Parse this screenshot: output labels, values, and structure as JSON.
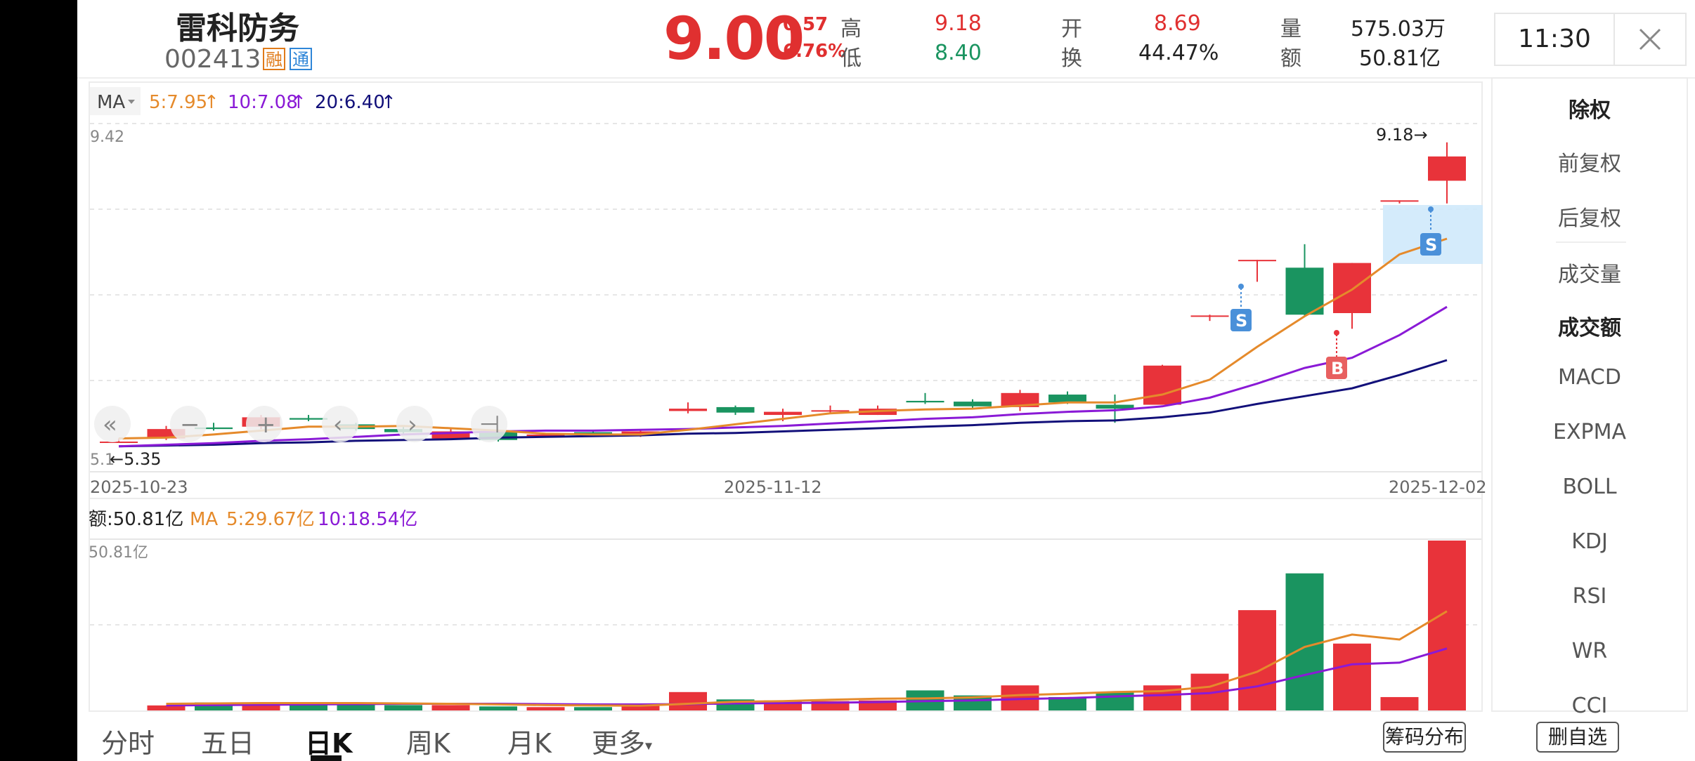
{
  "stock": {
    "name": "雷科防务",
    "code": "002413",
    "tags": [
      "融",
      "通"
    ],
    "price": "9.00",
    "change": "0.57",
    "change_pct": "6.76%",
    "high_label": "高",
    "high": "9.18",
    "low_label": "低",
    "low": "8.40",
    "open_label": "开",
    "open": "8.69",
    "turnover_label": "换",
    "turnover": "44.47%",
    "volume_label": "量",
    "volume": "575.03万",
    "amount_label": "额",
    "amount": "50.81亿"
  },
  "clock": "11:30",
  "colors": {
    "up": "#e8333a",
    "down": "#1a9460",
    "ma5": "#e58a2b",
    "ma10": "#8a1ad6",
    "ma20": "#12107a",
    "accent": "#2f86d8"
  },
  "ma_legend": {
    "selector": "MA",
    "ma5": "5:7.95",
    "ma10": "10:7.08",
    "ma20": "20:6.40",
    "arrow": "↑"
  },
  "price_axis": {
    "top": "9.42",
    "bottom": "5.1",
    "max_label": "9.18→",
    "min_label": "←5.35"
  },
  "dates": {
    "start": "2025-10-23",
    "mid": "2025-11-12",
    "end": "2025-12-02"
  },
  "markers": {
    "sell": "S",
    "buy": "B"
  },
  "volume_legend": {
    "amount": "额:50.81亿",
    "ma_label": "MA",
    "ma5": "5:29.67亿",
    "ma10": "10:18.54亿",
    "axis_top": "50.81亿"
  },
  "right_panel": [
    "除权",
    "前复权",
    "后复权",
    "成交量",
    "成交额",
    "MACD",
    "EXPMA",
    "BOLL",
    "KDJ",
    "RSI",
    "WR",
    "CCI"
  ],
  "tabs": [
    "分时",
    "五日",
    "日K",
    "周K",
    "月K",
    "更多"
  ],
  "buttons": {
    "chips": "筹码分布",
    "remove_watch": "删自选"
  },
  "zoom_controls": [
    "«",
    "−",
    "+",
    "‹",
    "›",
    "⊣"
  ],
  "chart_data": {
    "type": "candlestick",
    "price_range": [
      5.1,
      9.42
    ],
    "candles": [
      {
        "o": 5.35,
        "c": 5.36,
        "h": 5.4,
        "l": 5.35
      },
      {
        "o": 5.4,
        "c": 5.52,
        "h": 5.56,
        "l": 5.38
      },
      {
        "o": 5.54,
        "c": 5.52,
        "h": 5.6,
        "l": 5.5
      },
      {
        "o": 5.55,
        "c": 5.67,
        "h": 5.7,
        "l": 5.52
      },
      {
        "o": 5.66,
        "c": 5.64,
        "h": 5.7,
        "l": 5.62
      },
      {
        "o": 5.58,
        "c": 5.52,
        "h": 5.6,
        "l": 5.5
      },
      {
        "o": 5.52,
        "c": 5.48,
        "h": 5.56,
        "l": 5.46
      },
      {
        "o": 5.4,
        "c": 5.49,
        "h": 5.52,
        "l": 5.38
      },
      {
        "o": 5.49,
        "c": 5.38,
        "h": 5.5,
        "l": 5.36
      },
      {
        "o": 5.43,
        "c": 5.45,
        "h": 5.47,
        "l": 5.41
      },
      {
        "o": 5.48,
        "c": 5.47,
        "h": 5.5,
        "l": 5.45
      },
      {
        "o": 5.45,
        "c": 5.49,
        "h": 5.52,
        "l": 5.42
      },
      {
        "o": 5.75,
        "c": 5.78,
        "h": 5.86,
        "l": 5.72
      },
      {
        "o": 5.8,
        "c": 5.73,
        "h": 5.82,
        "l": 5.7
      },
      {
        "o": 5.7,
        "c": 5.74,
        "h": 5.78,
        "l": 5.62
      },
      {
        "o": 5.75,
        "c": 5.76,
        "h": 5.82,
        "l": 5.73
      },
      {
        "o": 5.7,
        "c": 5.78,
        "h": 5.82,
        "l": 5.7
      },
      {
        "o": 5.88,
        "c": 5.86,
        "h": 5.98,
        "l": 5.84
      },
      {
        "o": 5.87,
        "c": 5.81,
        "h": 5.9,
        "l": 5.78
      },
      {
        "o": 5.8,
        "c": 5.98,
        "h": 6.02,
        "l": 5.75
      },
      {
        "o": 5.96,
        "c": 5.86,
        "h": 6.0,
        "l": 5.84
      },
      {
        "o": 5.83,
        "c": 5.78,
        "h": 5.96,
        "l": 5.6
      },
      {
        "o": 5.83,
        "c": 6.33,
        "h": 6.34,
        "l": 5.83
      },
      {
        "o": 6.96,
        "c": 6.97,
        "h": 6.98,
        "l": 6.9
      },
      {
        "o": 7.67,
        "c": 7.68,
        "h": 7.68,
        "l": 7.4
      },
      {
        "o": 7.58,
        "c": 6.98,
        "h": 7.88,
        "l": 6.96
      },
      {
        "o": 7.0,
        "c": 7.64,
        "h": 7.64,
        "l": 6.8
      },
      {
        "o": 8.43,
        "c": 8.44,
        "h": 8.44,
        "l": 8.4
      },
      {
        "o": 8.69,
        "c": 9.0,
        "h": 9.18,
        "l": 8.4
      }
    ],
    "ma5": [
      5.4,
      5.41,
      5.45,
      5.5,
      5.55,
      5.55,
      5.56,
      5.53,
      5.5,
      5.46,
      5.45,
      5.45,
      5.51,
      5.58,
      5.65,
      5.72,
      5.75,
      5.77,
      5.78,
      5.82,
      5.86,
      5.86,
      5.96,
      6.15,
      6.57,
      6.96,
      7.3,
      7.75,
      7.95
    ],
    "ma10": [
      5.3,
      5.32,
      5.34,
      5.37,
      5.39,
      5.42,
      5.45,
      5.47,
      5.49,
      5.5,
      5.5,
      5.51,
      5.52,
      5.54,
      5.56,
      5.59,
      5.62,
      5.65,
      5.67,
      5.71,
      5.74,
      5.76,
      5.81,
      5.92,
      6.1,
      6.3,
      6.43,
      6.72,
      7.08
    ],
    "ma20": [
      5.3,
      5.31,
      5.32,
      5.34,
      5.35,
      5.37,
      5.38,
      5.39,
      5.41,
      5.42,
      5.43,
      5.44,
      5.46,
      5.47,
      5.49,
      5.51,
      5.53,
      5.55,
      5.57,
      5.6,
      5.62,
      5.63,
      5.67,
      5.73,
      5.84,
      5.94,
      6.04,
      6.21,
      6.4
    ],
    "amount_range": [
      0,
      50.81
    ],
    "amounts": [
      1.5,
      2.4,
      1.8,
      2.2,
      2.0,
      1.6,
      1.6,
      1.2,
      1.0,
      1.0,
      1.4,
      5.5,
      3.3,
      3.0,
      2.8,
      3.0,
      6.0,
      4.5,
      7.5,
      4.0,
      5.5,
      7.5,
      11.0,
      30.0,
      41.0,
      20.0,
      4.0,
      50.81
    ],
    "amount_ma5": [
      2.0,
      2.1,
      2.2,
      2.2,
      2.2,
      2.1,
      2.0,
      1.8,
      1.6,
      1.5,
      1.4,
      2.0,
      2.6,
      2.8,
      3.2,
      3.5,
      3.6,
      3.9,
      4.6,
      5.0,
      5.5,
      5.8,
      7.1,
      11.6,
      19.0,
      22.7,
      21.2,
      29.67
    ],
    "amount_ma10": [
      1.5,
      1.6,
      1.7,
      1.8,
      1.9,
      2.0,
      2.0,
      2.0,
      1.9,
      1.8,
      1.8,
      1.9,
      2.1,
      2.2,
      2.3,
      2.5,
      2.8,
      3.0,
      3.4,
      3.7,
      4.2,
      4.6,
      5.2,
      7.2,
      10.6,
      13.8,
      14.3,
      18.54
    ]
  }
}
